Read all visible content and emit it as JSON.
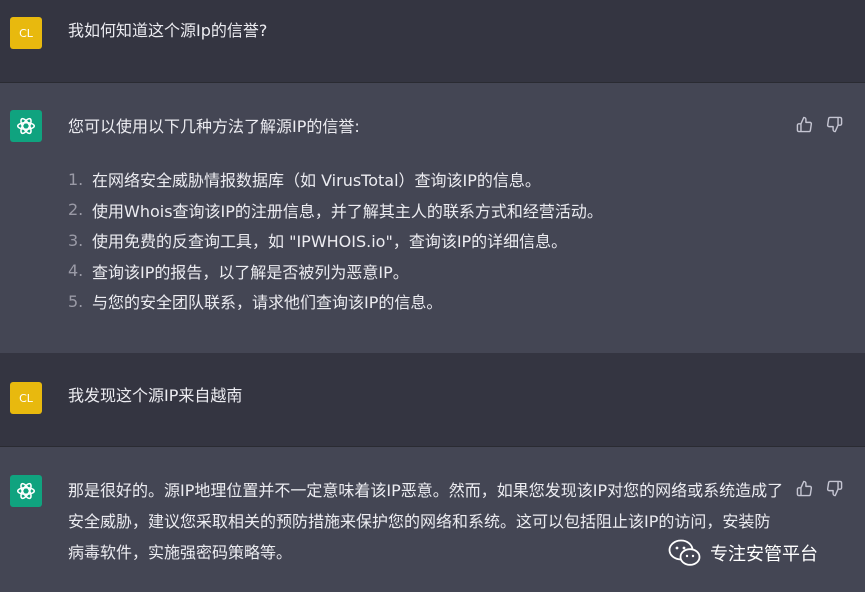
{
  "conversation": {
    "q1": {
      "avatar": "CL",
      "text": "我如何知道这个源Ip的信誉?"
    },
    "a1": {
      "intro": "您可以使用以下几种方法了解源IP的信誉:",
      "items": [
        {
          "num": "1.",
          "text": "在网络安全威胁情报数据库（如 VirusTotal）查询该IP的信息。"
        },
        {
          "num": "2.",
          "text": "使用Whois查询该IP的注册信息，并了解其主人的联系方式和经营活动。"
        },
        {
          "num": "3.",
          "text": "使用免费的反查询工具，如 \"IPWHOIS.io\"，查询该IP的详细信息。"
        },
        {
          "num": "4.",
          "text": "查询该IP的报告，以了解是否被列为恶意IP。"
        },
        {
          "num": "5.",
          "text": "与您的安全团队联系，请求他们查询该IP的信息。"
        }
      ]
    },
    "q2": {
      "avatar": "CL",
      "text": "我发现这个源IP来自越南"
    },
    "a2": {
      "text": "那是很好的。源IP地理位置并不一定意味着该IP恶意。然而，如果您发现该IP对您的网络或系统造成了安全威胁，建议您采取相关的预防措施来保护您的网络和系统。这可以包括阻止该IP的访问，安装防病毒软件，实施强密码策略等。"
    }
  },
  "icons": {
    "thumbs_up": "thumbs-up-icon",
    "thumbs_down": "thumbs-down-icon",
    "assistant_logo": "openai-logo-icon",
    "watermark_logo": "wechat-icon"
  },
  "watermark": {
    "text": "专注安管平台"
  },
  "colors": {
    "user_bg": "#343541",
    "assistant_bg": "#444654",
    "user_avatar": "#e8b90e",
    "assistant_avatar": "#10a37f",
    "text": "#ececf1"
  }
}
